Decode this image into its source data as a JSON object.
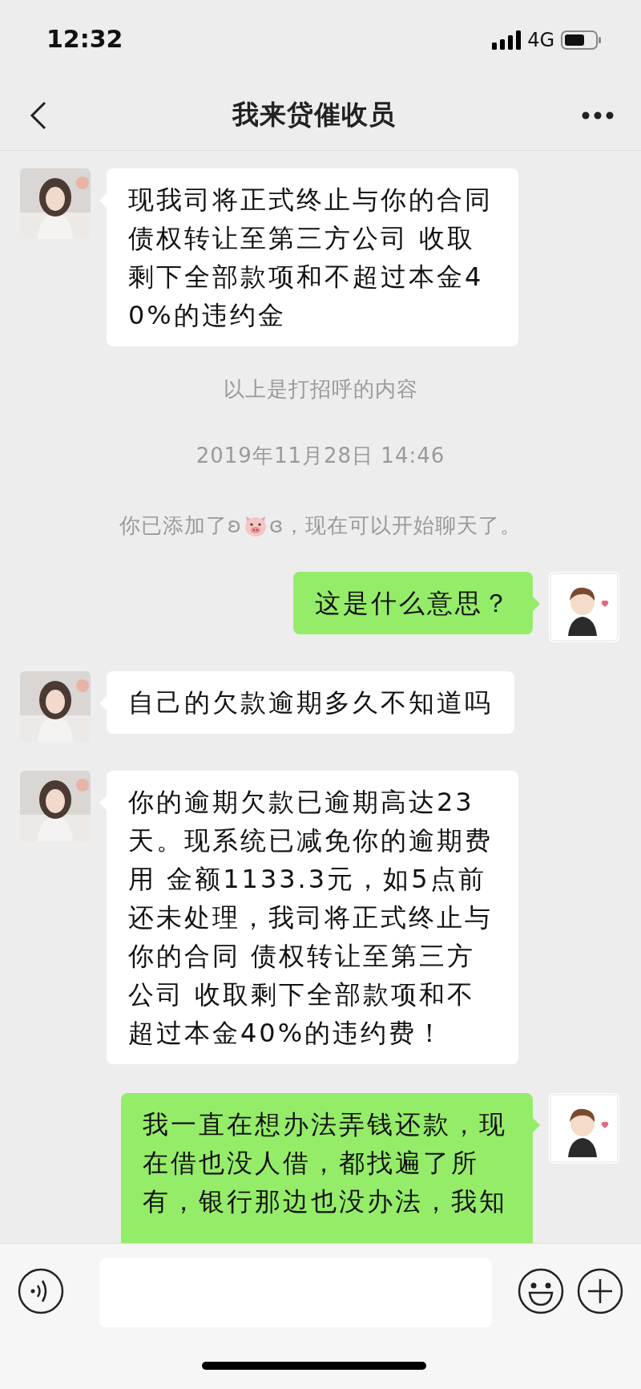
{
  "status_bar": {
    "time": "12:32",
    "network": "4G"
  },
  "header": {
    "title": "我来贷催收员"
  },
  "messages": [
    {
      "kind": "bubble",
      "outgoing": false,
      "text": "现我司将正式终止与你的合同债权转让至第三方公司 收取剩下全部款项和不超过本金40%的违约金"
    },
    {
      "kind": "notice",
      "text": "以上是打招呼的内容"
    },
    {
      "kind": "time",
      "text": "2019年11月28日 14:46"
    },
    {
      "kind": "added",
      "text_before": "你已添加了ʚ",
      "text_after": "ɞ，现在可以开始聊天了。"
    },
    {
      "kind": "bubble",
      "outgoing": true,
      "text": "这是什么意思？"
    },
    {
      "kind": "bubble",
      "outgoing": false,
      "text": "自己的欠款逾期多久不知道吗"
    },
    {
      "kind": "bubble",
      "outgoing": false,
      "text": "你的逾期欠款已逾期高达23天。现系统已减免你的逾期费用 金额1133.3元，如5点前还未处理，我司将正式终止与你的合同 债权转让至第三方公司 收取剩下全部款项和不超过本金40%的违约费！"
    },
    {
      "kind": "bubble",
      "outgoing": true,
      "text": "我一直在想办法弄钱还款，现在借也没人借，都找遍了所有，银行那边也没办法，我知"
    }
  ]
}
